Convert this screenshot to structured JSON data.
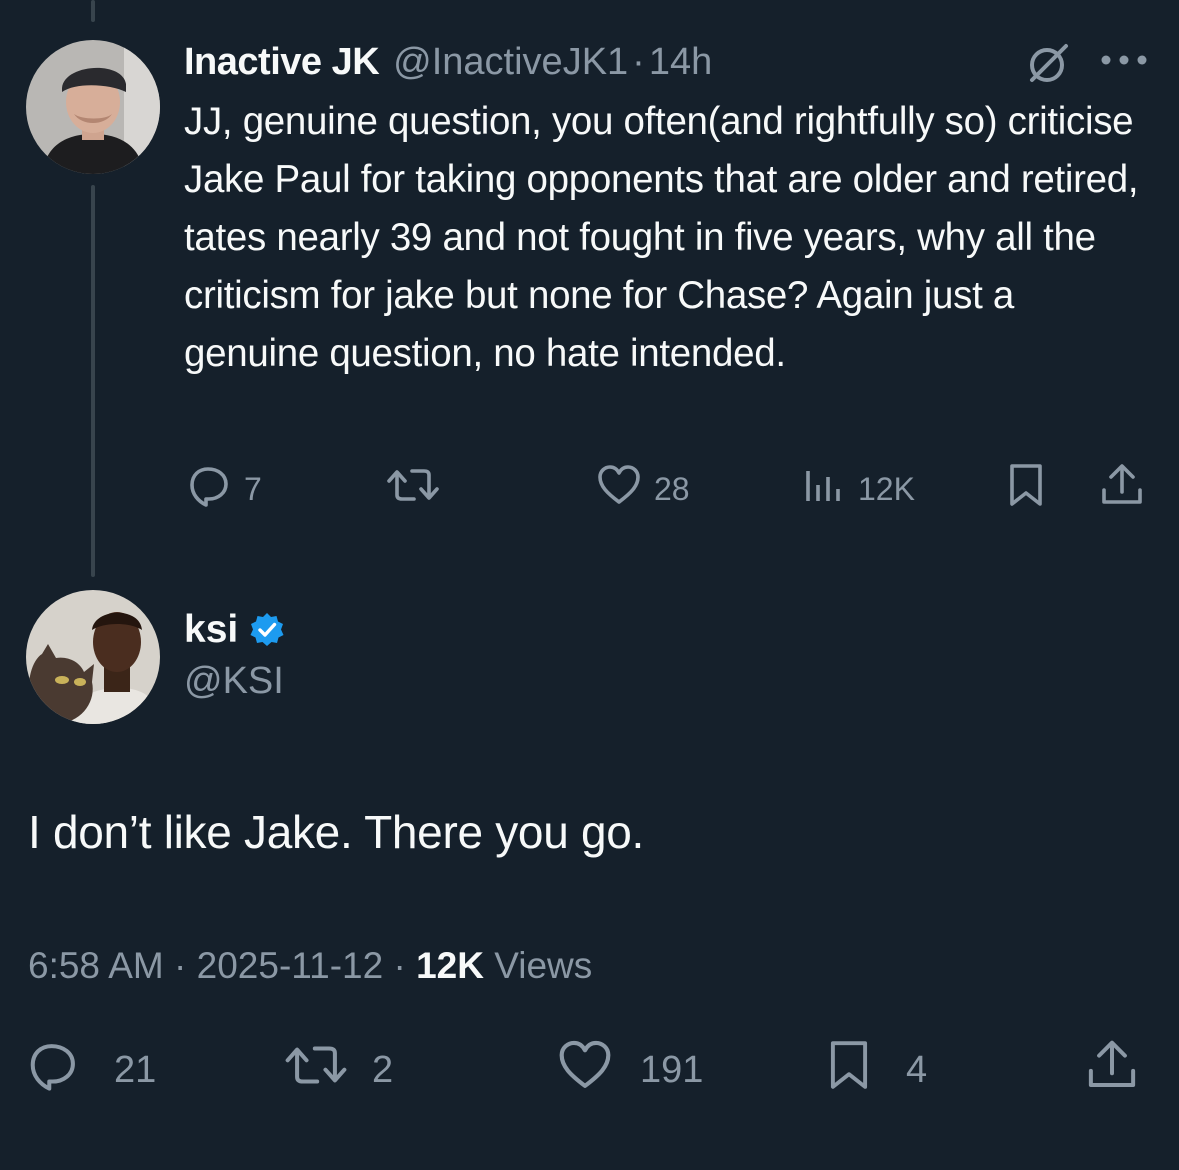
{
  "parent_tweet": {
    "author_name": "Inactive JK",
    "handle": "@InactiveJK1",
    "separator": "·",
    "time_ago": "14h",
    "text": "JJ, genuine question, you often(and rightfully so) criticise Jake Paul for taking opponents that are older and retired, tates nearly 39 and not fought in five years, why all the criticism for jake but none for Chase? Again just a genuine question, no hate intended.",
    "actions": {
      "reply_count": "7",
      "retweet_count": "",
      "like_count": "28",
      "views_count": "12K"
    },
    "icons": [
      "grok-icon",
      "more-icon",
      "reply-icon",
      "retweet-icon",
      "like-icon",
      "views-icon",
      "bookmark-icon",
      "share-icon"
    ]
  },
  "reply_tweet": {
    "author_name": "ksi",
    "handle": "@KSI",
    "verified": true,
    "text": "I don’t like Jake. There you go.",
    "time": "6:58 AM",
    "separator": "·",
    "date": "2025-11-12",
    "views_count": "12K",
    "views_label": "Views",
    "actions": {
      "reply_count": "21",
      "retweet_count": "2",
      "like_count": "191",
      "bookmark_count": "4"
    }
  },
  "colors": {
    "background": "#15202b",
    "text_primary": "#f7f9f9",
    "text_secondary": "#8b98a5",
    "thread_line": "#38444d",
    "verified": "#1d9bf0"
  }
}
